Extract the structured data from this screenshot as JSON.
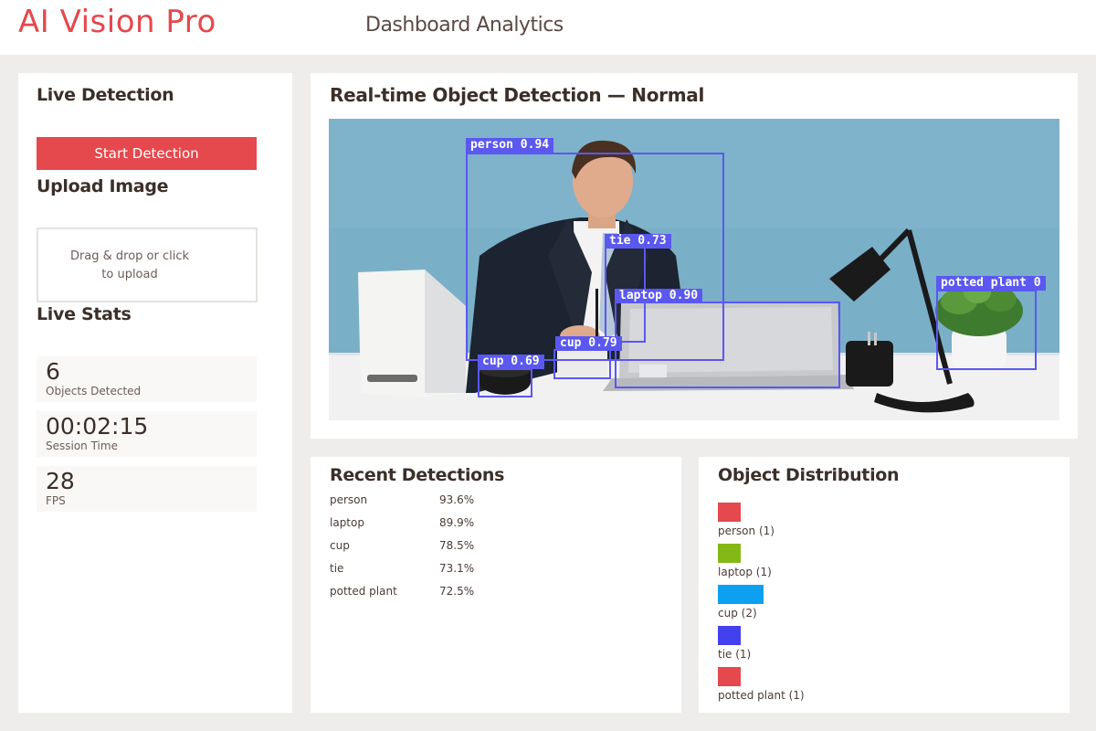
{
  "header": {
    "app_title": "AI Vision Pro",
    "subtitle": "Dashboard Analytics"
  },
  "sidebar": {
    "live_detection_title": "Live Detection",
    "start_button_label": "Start Detection",
    "upload_title": "Upload Image",
    "upload_hint_line1": "Drag & drop or click",
    "upload_hint_line2": "to upload",
    "live_stats_title": "Live Stats",
    "stats": [
      {
        "value": "6",
        "label": "Objects Detected"
      },
      {
        "value": "00:02:15",
        "label": "Session Time"
      },
      {
        "value": "28",
        "label": "FPS"
      }
    ]
  },
  "detection": {
    "title": "Real-time Object Detection — Normal",
    "box_color": "#5b58f0",
    "boxes": [
      {
        "label": "person 0.94"
      },
      {
        "label": "tie 0.73"
      },
      {
        "label": "laptop 0.90"
      },
      {
        "label": "cup 0.79"
      },
      {
        "label": "cup 0.69"
      },
      {
        "label": "potted plant 0"
      }
    ]
  },
  "recent": {
    "title": "Recent Detections",
    "rows": [
      {
        "name": "person",
        "confidence": "93.6%"
      },
      {
        "name": "laptop",
        "confidence": "89.9%"
      },
      {
        "name": "cup",
        "confidence": "78.5%"
      },
      {
        "name": "tie",
        "confidence": "73.1%"
      },
      {
        "name": "potted plant",
        "confidence": "72.5%"
      }
    ]
  },
  "distribution": {
    "title": "Object Distribution",
    "items": [
      {
        "label": "person (1)",
        "count": 1,
        "color": "#e5484d"
      },
      {
        "label": "laptop (1)",
        "count": 1,
        "color": "#84b816"
      },
      {
        "label": "cup (2)",
        "count": 2,
        "color": "#0ea0f0"
      },
      {
        "label": "tie (1)",
        "count": 1,
        "color": "#4341ef"
      },
      {
        "label": "potted plant (1)",
        "count": 1,
        "color": "#e5484d"
      }
    ]
  },
  "colors": {
    "accent": "#e5484d",
    "detection_box": "#5b58f0"
  }
}
